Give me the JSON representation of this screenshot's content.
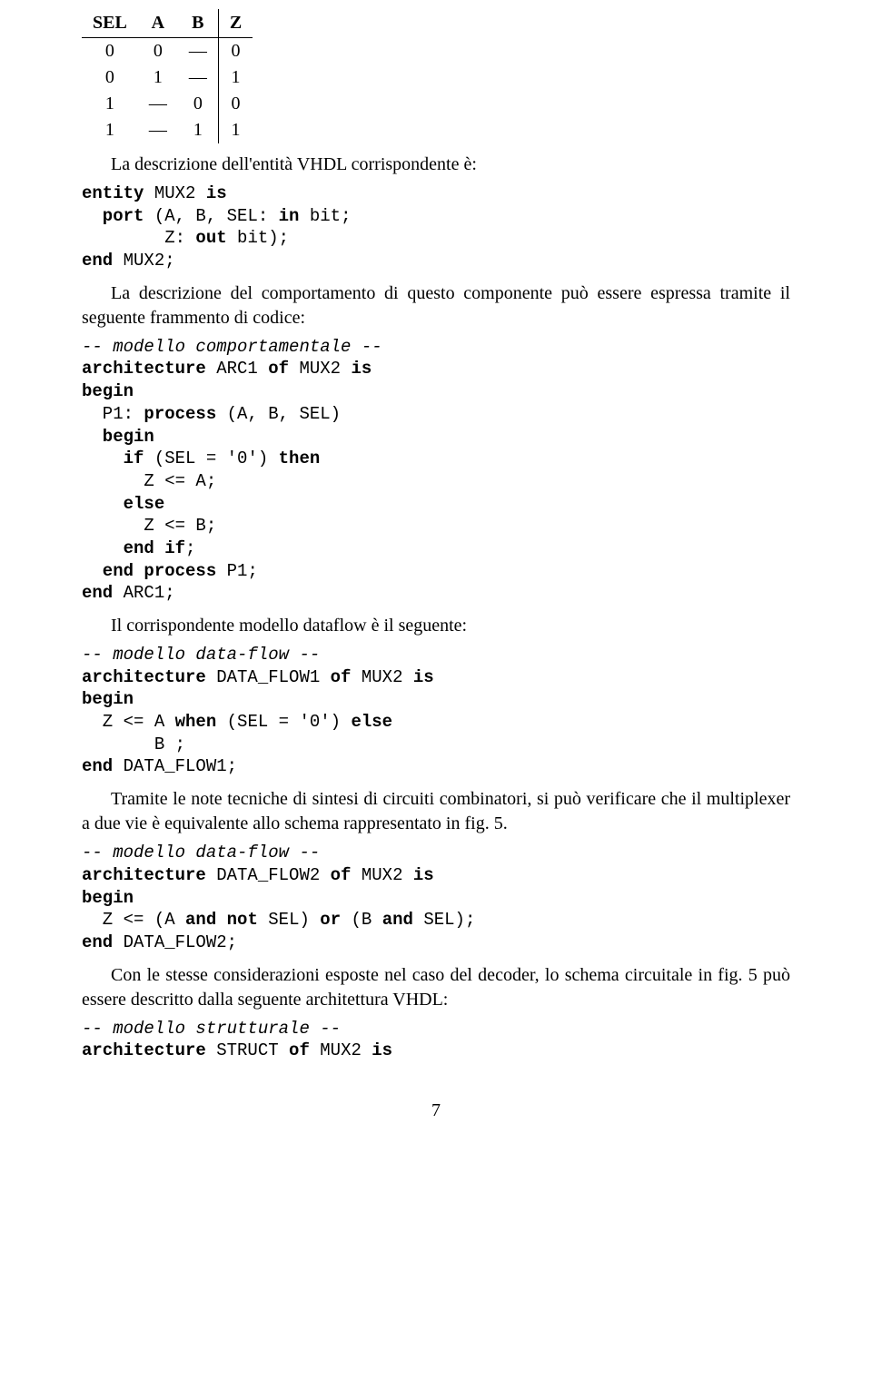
{
  "table": {
    "headers": [
      "SEL",
      "A",
      "B",
      "Z"
    ],
    "rows": [
      [
        "0",
        "0",
        "—",
        "0"
      ],
      [
        "0",
        "1",
        "—",
        "1"
      ],
      [
        "1",
        "—",
        "0",
        "0"
      ],
      [
        "1",
        "—",
        "1",
        "1"
      ]
    ]
  },
  "para1": "La descrizione dell'entità VHDL corrispondente è:",
  "code1": {
    "l1a": "entity",
    "l1b": " MUX2 ",
    "l1c": "is",
    "l2a": "  port",
    "l2b": " (A, B, SEL: ",
    "l2c": "in",
    "l2d": " bit;",
    "l3a": "        Z: ",
    "l3b": "out",
    "l3c": " bit);",
    "l4a": "end",
    "l4b": " MUX2;"
  },
  "para2": "La descrizione del comportamento di questo componente può essere espressa tramite il seguente frammento di codice:",
  "code2": {
    "c1": "-- modello comportamentale --",
    "l2a": "architecture",
    "l2b": " ARC1 ",
    "l2c": "of",
    "l2d": " MUX2 ",
    "l2e": "is",
    "l3": "begin",
    "l4a": "  P1: ",
    "l4b": "process",
    "l4c": " (A, B, SEL)",
    "l5": "  begin",
    "l6a": "    if",
    "l6b": " (SEL = '0') ",
    "l6c": "then",
    "l7": "      Z <= A;",
    "l8": "    else",
    "l9": "      Z <= B;",
    "l10a": "    end",
    "l10b": " ",
    "l10c": "if",
    "l10d": ";",
    "l11a": "  end",
    "l11b": " ",
    "l11c": "process",
    "l11d": " P1;",
    "l12a": "end",
    "l12b": " ARC1;"
  },
  "para3": "Il corrispondente modello dataflow è il seguente:",
  "code3": {
    "c1": "-- modello data-flow --",
    "l2a": "architecture",
    "l2b": " DATA_FLOW1 ",
    "l2c": "of",
    "l2d": " MUX2 ",
    "l2e": "is",
    "l3": "begin",
    "l4a": "  Z <= A ",
    "l4b": "when",
    "l4c": " (SEL = '0') ",
    "l4d": "else",
    "l5": "       B ;",
    "l6a": "end",
    "l6b": " DATA_FLOW1;"
  },
  "para4": "Tramite le note tecniche di sintesi di circuiti combinatori, si può verificare che il multiplexer a due vie è equivalente allo schema rappresentato in fig. 5.",
  "code4": {
    "c1": "-- modello data-flow --",
    "l2a": "architecture",
    "l2b": " DATA_FLOW2 ",
    "l2c": "of",
    "l2d": " MUX2 ",
    "l2e": "is",
    "l3": "begin",
    "l4a": "  Z <= (A ",
    "l4b": "and",
    "l4c": " ",
    "l4d": "not",
    "l4e": " SEL) ",
    "l4f": "or",
    "l4g": " (B ",
    "l4h": "and",
    "l4i": " SEL);",
    "l5a": "end",
    "l5b": " DATA_FLOW2;"
  },
  "para5": "Con le stesse considerazioni esposte nel caso del decoder, lo schema circuitale in fig. 5 può essere descritto dalla seguente architettura VHDL:",
  "code5": {
    "c1": "-- modello strutturale --",
    "l2a": "architecture",
    "l2b": " STRUCT ",
    "l2c": "of",
    "l2d": " MUX2 ",
    "l2e": "is"
  },
  "pagenum": "7"
}
